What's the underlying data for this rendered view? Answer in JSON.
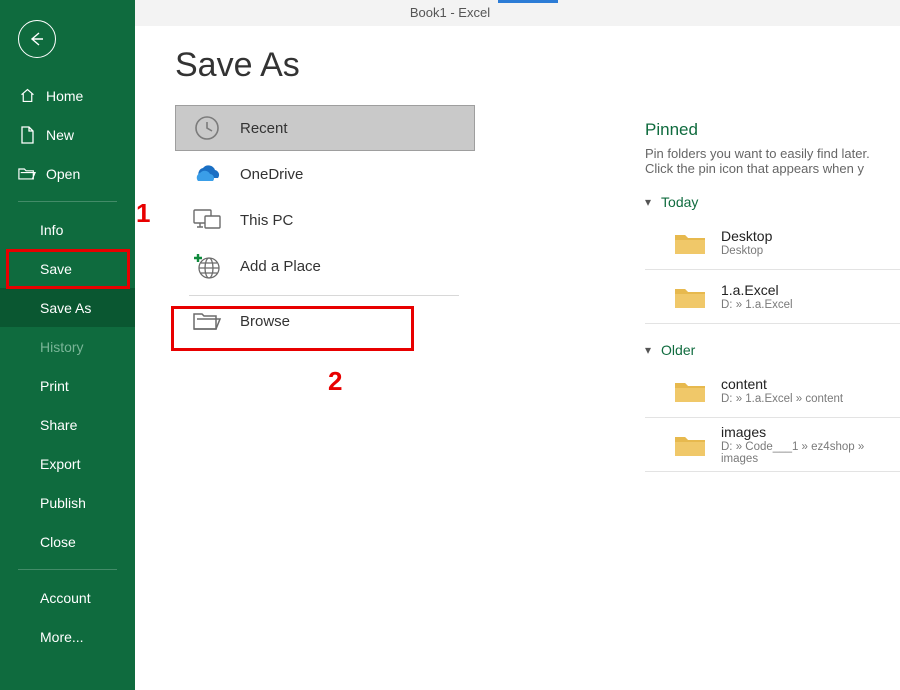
{
  "titlebar": {
    "text": "Book1  -  Excel"
  },
  "sidebar": {
    "back": "Back",
    "home": "Home",
    "new": "New",
    "open": "Open",
    "info": "Info",
    "save": "Save",
    "saveAs": "Save As",
    "history": "History",
    "print": "Print",
    "share": "Share",
    "export": "Export",
    "publish": "Publish",
    "close": "Close",
    "account": "Account",
    "more": "More..."
  },
  "page": {
    "title": "Save As"
  },
  "locations": {
    "recent": "Recent",
    "onedrive": "OneDrive",
    "thispc": "This PC",
    "addplace": "Add a Place",
    "browse": "Browse"
  },
  "pinned": {
    "heading": "Pinned",
    "hint": "Pin folders you want to easily find later. Click the pin icon that appears when y"
  },
  "groups": {
    "today": {
      "label": "Today",
      "items": [
        {
          "name": "Desktop",
          "path": "Desktop"
        },
        {
          "name": "1.a.Excel",
          "path": "D: » 1.a.Excel"
        }
      ]
    },
    "older": {
      "label": "Older",
      "items": [
        {
          "name": "content",
          "path": "D: » 1.a.Excel » content"
        },
        {
          "name": "images",
          "path": "D: » Code___1 » ez4shop » images"
        }
      ]
    }
  },
  "annotations": {
    "one": "1",
    "two": "2"
  }
}
